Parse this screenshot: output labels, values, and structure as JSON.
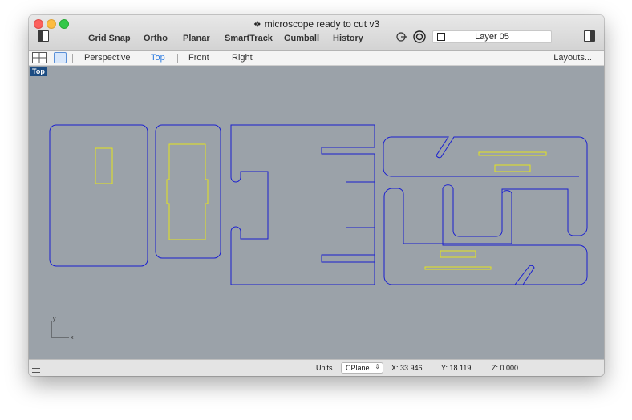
{
  "window": {
    "title": "microscope ready to cut v3",
    "title_icon": "rhino-icon"
  },
  "modes": [
    "Grid Snap",
    "Ortho",
    "Planar",
    "SmartTrack",
    "Gumball",
    "History"
  ],
  "layer": {
    "name": "Layer 05"
  },
  "viewport_tabs": [
    "Perspective",
    "Top",
    "Front",
    "Right"
  ],
  "active_tab": "Top",
  "layouts_label": "Layouts...",
  "viewport": {
    "label": "Top",
    "axis_x": "x",
    "axis_y": "y"
  },
  "status": {
    "units_label": "Units",
    "cplane_value": "CPlane",
    "x": "X: 33.946",
    "y": "Y: 18.119",
    "z": "Z: 0.000"
  },
  "colors": {
    "curve": "#1a1fd0",
    "selected_curve": "#e4e41a",
    "viewport_bg": "#9ba2a9",
    "active_tab": "#2b7ae0"
  }
}
